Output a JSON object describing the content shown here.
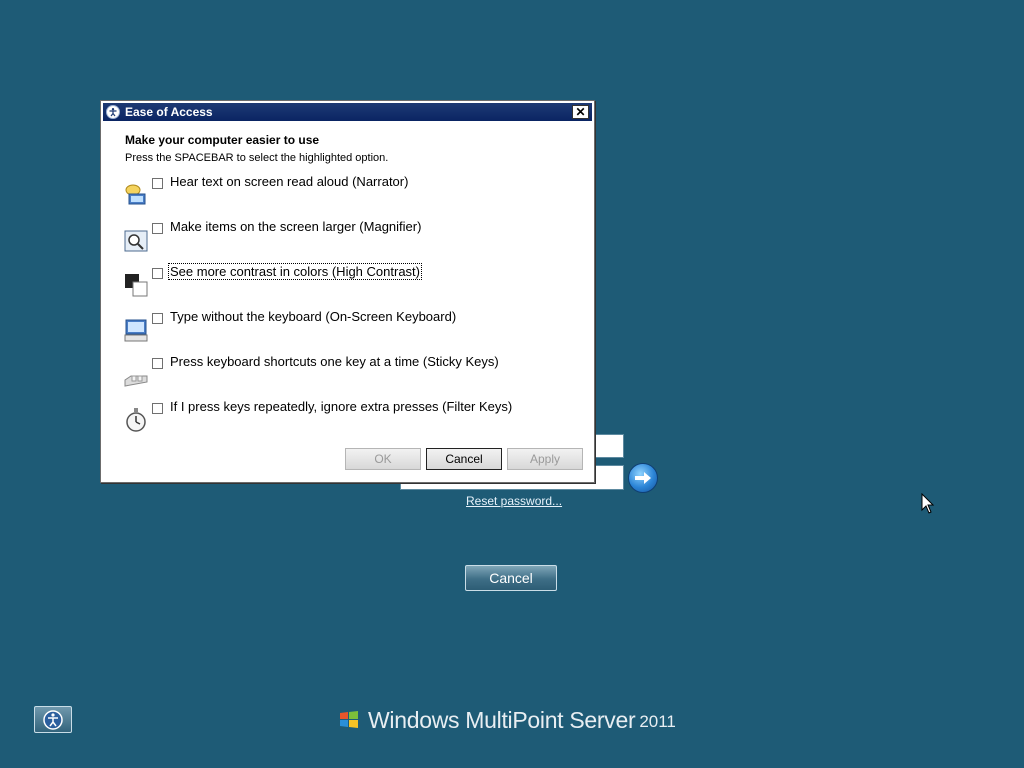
{
  "login": {
    "reset_link": "Reset password...",
    "cancel_label": "Cancel"
  },
  "branding": {
    "product": "Windows MultiPoint Server",
    "year": "2011"
  },
  "dialog": {
    "title": "Ease of Access",
    "close_label": "✕",
    "heading": "Make your computer easier to use",
    "instruction": "Press the SPACEBAR to select the highlighted option.",
    "options": [
      {
        "label": "Hear text on screen read aloud (Narrator)",
        "icon": "narrator-icon",
        "checked": false
      },
      {
        "label": "Make items on the screen larger (Magnifier)",
        "icon": "magnifier-icon",
        "checked": false
      },
      {
        "label": "See more contrast in colors (High Contrast)",
        "icon": "high-contrast-icon",
        "checked": false,
        "focused": true
      },
      {
        "label": "Type without the keyboard (On-Screen Keyboard)",
        "icon": "on-screen-keyboard-icon",
        "checked": false
      },
      {
        "label": "Press keyboard shortcuts one key at a time (Sticky Keys)",
        "icon": "sticky-keys-icon",
        "checked": false
      },
      {
        "label": "If I press keys repeatedly, ignore extra presses (Filter Keys)",
        "icon": "filter-keys-icon",
        "checked": false
      }
    ],
    "buttons": {
      "ok": "OK",
      "cancel": "Cancel",
      "apply": "Apply"
    }
  },
  "colors": {
    "desktop_bg": "#1e5b76",
    "titlebar": "#0a2463"
  }
}
